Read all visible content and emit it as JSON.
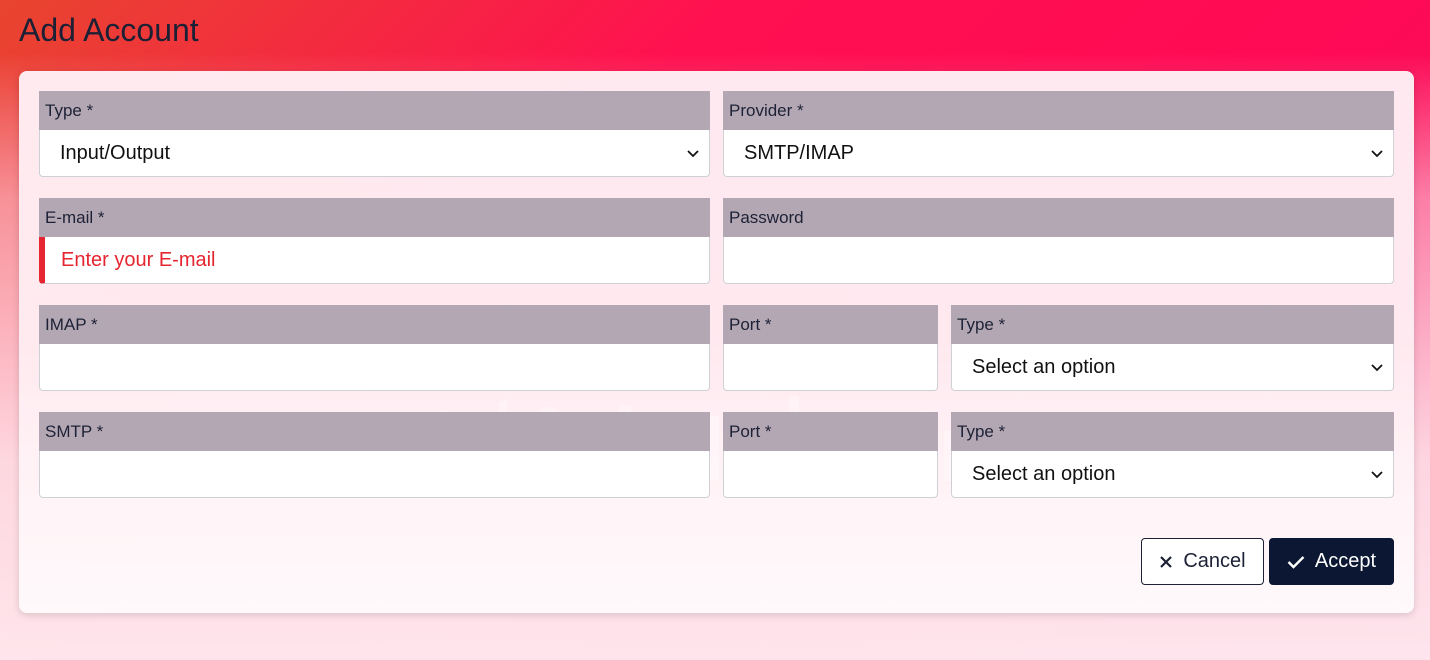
{
  "page": {
    "title": "Add Account"
  },
  "form": {
    "type": {
      "label": "Type *",
      "value": "Input/Output"
    },
    "provider": {
      "label": "Provider *",
      "value": "SMTP/IMAP"
    },
    "email": {
      "label": "E-mail *",
      "value": "",
      "placeholder": "Enter your E-mail"
    },
    "password": {
      "label": "Password",
      "value": ""
    },
    "imap": {
      "label": "IMAP *",
      "value": "",
      "port_label": "Port *",
      "port_value": "",
      "type_label": "Type *",
      "type_value": "Select an option"
    },
    "smtp": {
      "label": "SMTP *",
      "value": "",
      "port_label": "Port *",
      "port_value": "",
      "type_label": "Type *",
      "type_value": "Select an option"
    }
  },
  "actions": {
    "cancel_label": "Cancel",
    "cancel_icon": "close-icon",
    "accept_label": "Accept",
    "accept_icon": "check-icon"
  },
  "colors": {
    "label_bg": "#b3a7b3",
    "error": "#e5252f",
    "primary": "#0b1733",
    "header_gradient": [
      "#e8452f",
      "#ff1050"
    ]
  }
}
